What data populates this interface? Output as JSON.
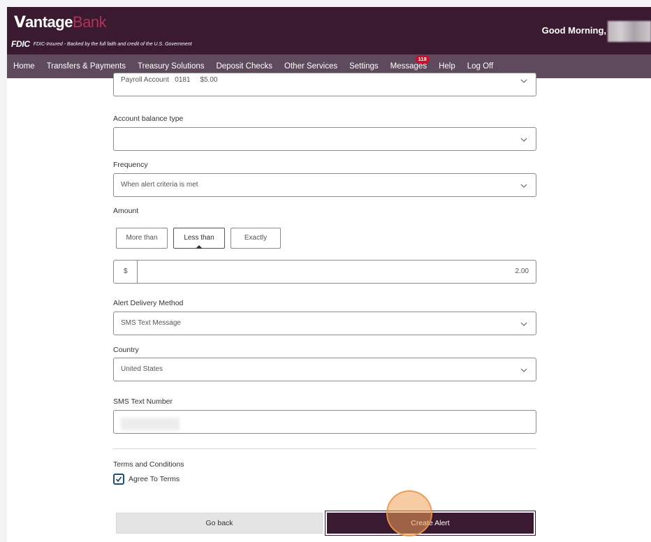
{
  "header": {
    "logo_v": "V",
    "logo_antage": "antage",
    "logo_bank": "Bank",
    "fdic_mark": "FDIC",
    "fdic_text": "FDIC-Insured - Backed by the full faith and credit of the U.S. Government",
    "greeting": "Good Morning,"
  },
  "nav": {
    "items": [
      "Home",
      "Transfers & Payments",
      "Treasury Solutions",
      "Deposit Checks",
      "Other Services",
      "Settings",
      "Messages",
      "Help",
      "Log Off"
    ],
    "messages_badge": "118"
  },
  "form": {
    "account": {
      "name": "Payroll Account",
      "number": "0181",
      "balance": "$5.00"
    },
    "balance_type": {
      "label": "Account balance type",
      "value": ""
    },
    "frequency": {
      "label": "Frequency",
      "value": "When alert criteria is met"
    },
    "amount": {
      "label": "Amount",
      "options": [
        "More than",
        "Less than",
        "Exactly"
      ],
      "selected": "Less than",
      "currency": "$",
      "value": "2.00"
    },
    "delivery": {
      "label": "Alert Delivery Method",
      "value": "SMS Text Message"
    },
    "country": {
      "label": "Country",
      "value": "United States"
    },
    "sms": {
      "label": "SMS Text Number",
      "value": ""
    },
    "terms": {
      "label": "Terms and Conditions",
      "checkbox_label": "Agree To Terms",
      "checked": true
    },
    "buttons": {
      "back": "Go back",
      "create": "Create Alert"
    }
  },
  "colors": {
    "header_bg": "#3a1a30",
    "nav_bg": "#5e4a5c",
    "brand_accent": "#b0325a",
    "badge": "#c8102e",
    "checkbox": "#1f4e79"
  },
  "icons": [
    "chevron-down-icon",
    "checkmark-icon"
  ]
}
